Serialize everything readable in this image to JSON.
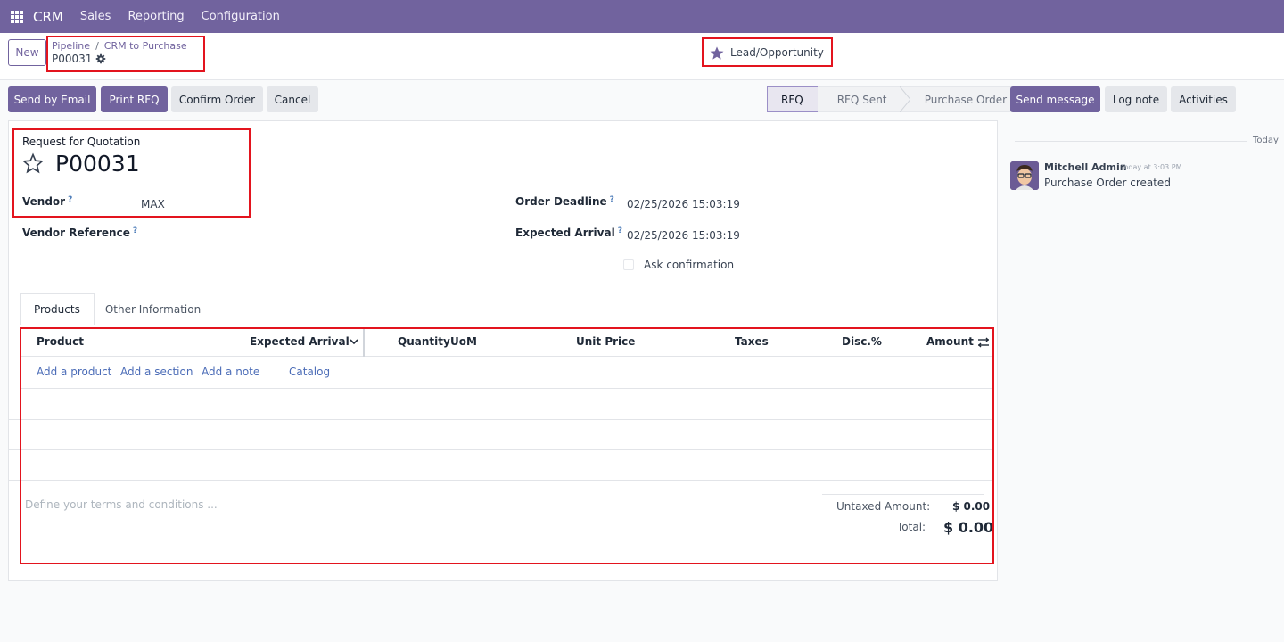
{
  "navbar": {
    "app_name": "CRM",
    "menus": [
      "Sales",
      "Reporting",
      "Configuration"
    ]
  },
  "control_panel": {
    "new_label": "New",
    "breadcrumb": [
      "Pipeline",
      "CRM to Purchase"
    ],
    "record_name": "P00031",
    "smart_button": "Lead/Opportunity"
  },
  "actions": {
    "send_email": "Send by Email",
    "print_rfq": "Print RFQ",
    "confirm_order": "Confirm Order",
    "cancel": "Cancel"
  },
  "statusbar": {
    "stages": [
      "RFQ",
      "RFQ Sent",
      "Purchase Order"
    ],
    "active": "RFQ"
  },
  "form": {
    "doc_type": "Request for Quotation",
    "name": "P00031",
    "vendor_label": "Vendor",
    "vendor_value": "MAX",
    "vendor_ref_label": "Vendor Reference",
    "order_deadline_label": "Order Deadline",
    "order_deadline_value": "02/25/2026 15:03:19",
    "expected_arrival_label": "Expected Arrival",
    "expected_arrival_value": "02/25/2026 15:03:19",
    "ask_confirmation_label": "Ask confirmation",
    "help_mark": "?"
  },
  "tabs": [
    "Products",
    "Other Information"
  ],
  "lines_table": {
    "columns": {
      "product": "Product",
      "expected_arrival": "Expected Arrival",
      "quantity": "Quantity",
      "uom": "UoM",
      "unit_price": "Unit Price",
      "taxes": "Taxes",
      "discount": "Disc.%",
      "amount": "Amount"
    },
    "add_links": [
      "Add a product",
      "Add a section",
      "Add a note",
      "Catalog"
    ]
  },
  "footer": {
    "terms_placeholder": "Define your terms and conditions ...",
    "untaxed_label": "Untaxed Amount:",
    "untaxed_value": "$ 0.00",
    "total_label": "Total:",
    "total_value": "$ 0.00"
  },
  "chatter": {
    "send_message": "Send message",
    "log_note": "Log note",
    "activities": "Activities",
    "date_separator": "Today",
    "author": "Mitchell Admin",
    "time": "Today at 3:03 PM",
    "message": "Purchase Order created"
  },
  "colors": {
    "brand": "#71639e",
    "highlight": "#e3141e"
  }
}
